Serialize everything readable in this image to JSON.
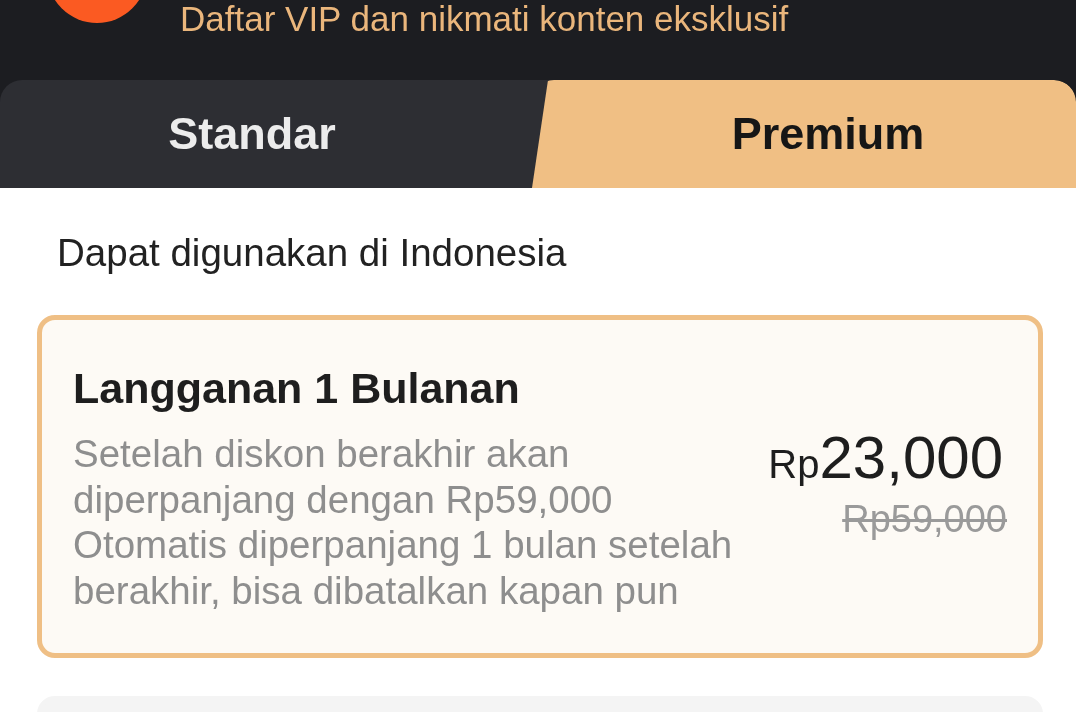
{
  "header": {
    "title": "Daftar VIP dan nikmati konten eksklusif"
  },
  "tabs": [
    {
      "label": "Standar",
      "selected": false
    },
    {
      "label": "Premium",
      "selected": true
    }
  ],
  "region_note": "Dapat digunakan di Indonesia",
  "plans": [
    {
      "title": "Langganan 1 Bulanan",
      "description": [
        "Setelah diskon berakhir akan diperpanjang dengan Rp59,000",
        "Otomatis diperpanjang 1 bulan setelah berakhir, bisa dibatalkan kapan pun"
      ],
      "currency": "Rp",
      "price": "23,000",
      "original_price": "Rp59,000",
      "selected": true
    },
    {
      "selected": false
    }
  ]
}
